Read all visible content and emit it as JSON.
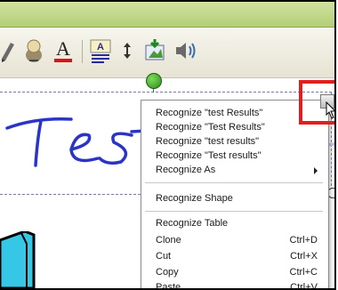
{
  "toolbar": {
    "icons": [
      "pen-tool-icon",
      "highlighter-icon",
      "font-color-icon",
      "text-format-icon",
      "spacing-icon",
      "insert-picture-icon",
      "audio-icon"
    ],
    "font_color_glyph": "A",
    "text_format_glyph": "A"
  },
  "canvas": {
    "handwriting_text": "Test Results"
  },
  "context_menu": {
    "items": [
      {
        "label": "Recognize \"test Results\"",
        "shortcut": ""
      },
      {
        "label": "Recognize \"Test Results\"",
        "shortcut": ""
      },
      {
        "label": "Recognize \"test results\"",
        "shortcut": ""
      },
      {
        "label": "Recognize \"Test results\"",
        "shortcut": ""
      },
      {
        "label": "Recognize As",
        "shortcut": "",
        "submenu": true
      },
      {
        "label": "Recognize Shape",
        "shortcut": ""
      },
      {
        "label": "Recognize Table",
        "shortcut": ""
      },
      {
        "label": "Clone",
        "shortcut": "Ctrl+D"
      },
      {
        "label": "Cut",
        "shortcut": "Ctrl+X"
      },
      {
        "label": "Copy",
        "shortcut": "Ctrl+C"
      },
      {
        "label": "Paste",
        "shortcut": "Ctrl+V"
      }
    ]
  },
  "colors": {
    "titlebar": "#b5ce78",
    "ink": "#2a35c8",
    "highlight_box": "#e02020",
    "rotate_handle": "#2e8c1e"
  }
}
